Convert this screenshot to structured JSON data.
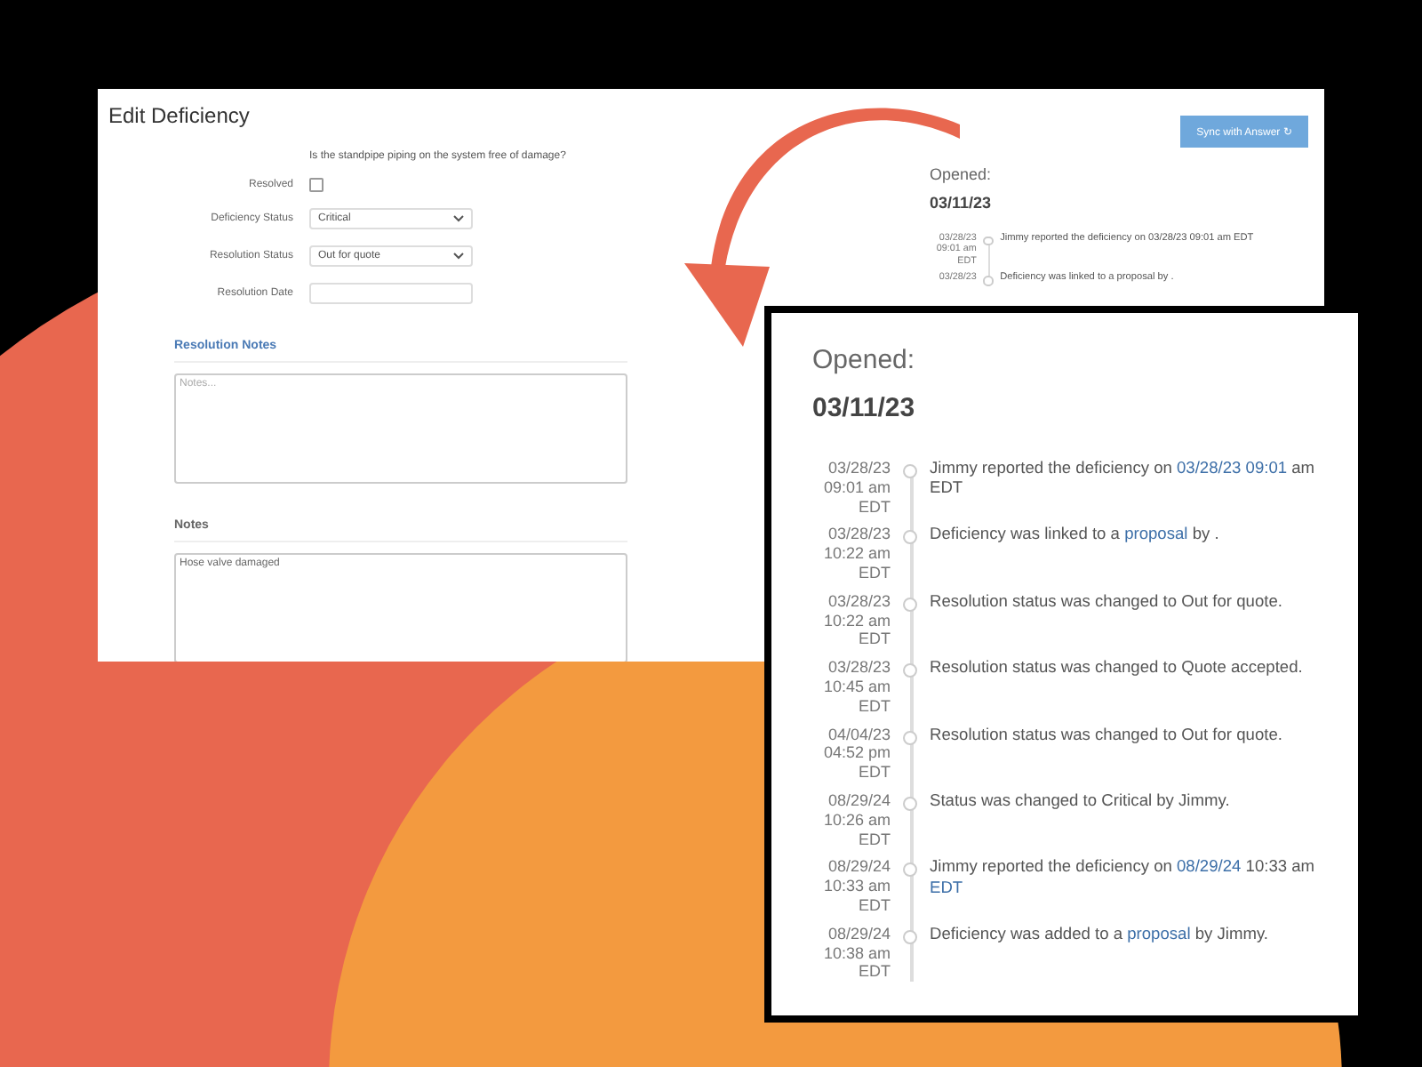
{
  "edit_window": {
    "title": "Edit Deficiency",
    "sync_button": "Sync with Answer ↻",
    "question": "Is the standpipe piping on the system free of damage?",
    "fields": [
      {
        "kind": "checkbox",
        "label": "Resolved",
        "checked": false
      },
      {
        "kind": "select",
        "label": "Deficiency Status",
        "value": "Critical"
      },
      {
        "kind": "select",
        "label": "Resolution Status",
        "value": "Out for quote"
      },
      {
        "kind": "text",
        "label": "Resolution Date"
      }
    ],
    "sections": [
      {
        "heading": "Resolution Notes",
        "placeholder": "Notes...",
        "selected": true
      },
      {
        "heading": "Notes",
        "value": "Hose valve damaged",
        "selected": false
      }
    ],
    "history": {
      "opened_label": "Opened:",
      "opened_date": "03/11/23",
      "entries": [
        {
          "date": "03/28/23",
          "time": "09:01 am",
          "zone": "EDT",
          "parts": [
            {
              "text": "Jimmy reported the deficiency on ",
              "link": false
            },
            {
              "text": "03/28/23 09:01 am EDT",
              "link": false
            }
          ]
        },
        {
          "date": "03/28/23",
          "parts": [
            {
              "text": "Deficiency was linked to a proposal by .",
              "link": false
            }
          ]
        }
      ]
    }
  },
  "zoom_panel": {
    "opened_label": "Opened:",
    "opened_date": "03/11/23",
    "entries": [
      {
        "date": "03/28/23",
        "time": "09:01 am",
        "zone": "EDT",
        "parts": [
          {
            "text": "Jimmy reported the deficiency on ",
            "link": false
          },
          {
            "text": "03/28/23 09:01",
            "link": true
          },
          {
            "text": " am EDT",
            "link": false
          }
        ]
      },
      {
        "date": "03/28/23",
        "time": "10:22 am",
        "zone": "EDT",
        "parts": [
          {
            "text": "Deficiency was linked to a ",
            "link": false
          },
          {
            "text": "proposal",
            "link": true
          },
          {
            "text": " by .",
            "link": false
          }
        ]
      },
      {
        "date": "03/28/23",
        "time": "10:22 am",
        "zone": "EDT",
        "parts": [
          {
            "text": "Resolution status was changed to Out for quote.",
            "link": false
          }
        ]
      },
      {
        "date": "03/28/23",
        "time": "10:45 am",
        "zone": "EDT",
        "parts": [
          {
            "text": "Resolution status was changed to Quote accepted.",
            "link": false
          }
        ]
      },
      {
        "date": "04/04/23",
        "time": "04:52 pm",
        "zone": "EDT",
        "parts": [
          {
            "text": "Resolution status was changed to Out for quote.",
            "link": false
          }
        ]
      },
      {
        "date": "08/29/24",
        "time": "10:26 am",
        "zone": "EDT",
        "parts": [
          {
            "text": "Status was changed to Critical by Jimmy.",
            "link": false
          }
        ]
      },
      {
        "date": "08/29/24",
        "time": "10:33 am",
        "zone": "EDT",
        "parts": [
          {
            "text": "Jimmy reported the deficiency on ",
            "link": false
          },
          {
            "text": "08/29/24",
            "link": true
          },
          {
            "text": " 10:33 am ",
            "link": false
          },
          {
            "text": "EDT",
            "link": true
          }
        ]
      },
      {
        "date": "08/29/24",
        "time": "10:38 am",
        "zone": "EDT",
        "parts": [
          {
            "text": "Deficiency was added to a ",
            "link": false
          },
          {
            "text": "proposal",
            "link": true
          },
          {
            "text": " by Jimmy.",
            "link": false
          }
        ]
      }
    ]
  }
}
